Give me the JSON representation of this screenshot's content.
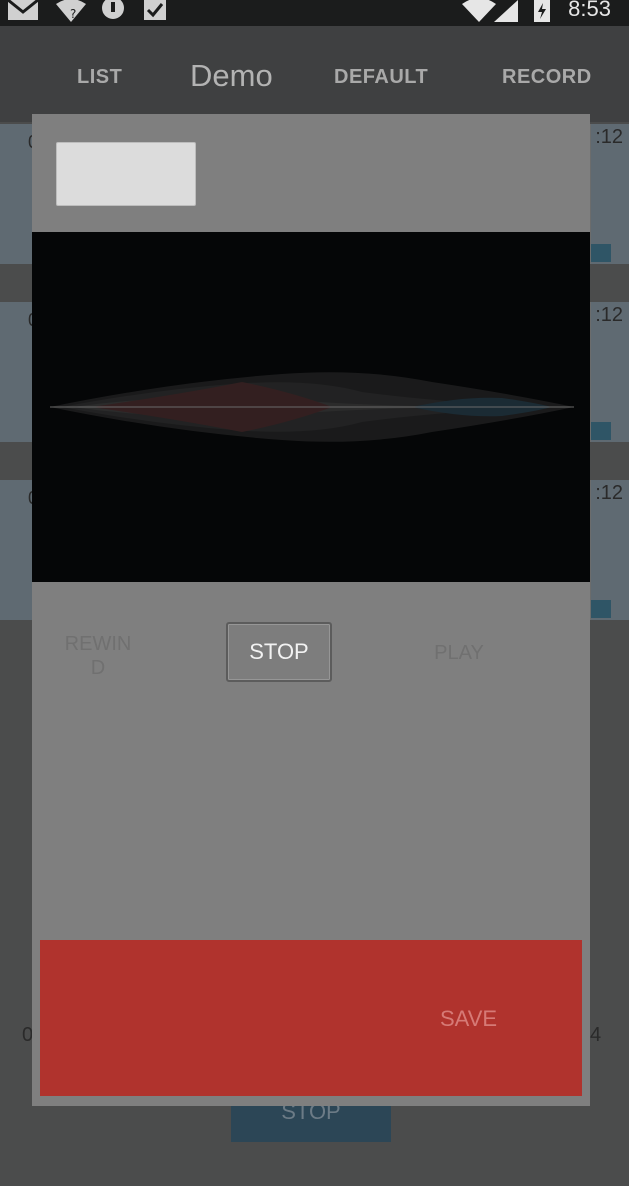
{
  "status_bar": {
    "time": "8:53",
    "icons": [
      "gmail-icon",
      "wifi-question-icon",
      "notification-icon",
      "check-icon",
      "wifi-icon",
      "signal-icon",
      "battery-charging-icon"
    ]
  },
  "app_bar": {
    "title": "Demo",
    "tabs": [
      "LIST",
      "DEFAULT",
      "RECORD"
    ]
  },
  "background_list": {
    "rows": [
      {
        "duration": ":12",
        "prefix": "0"
      },
      {
        "duration": ":12",
        "prefix": "0"
      },
      {
        "duration": ":12",
        "prefix": "0"
      }
    ],
    "bottom_left": "0",
    "bottom_right": "4",
    "stop_button": "STOP"
  },
  "dialog": {
    "buttons": {
      "rewind": "REWIN\nD",
      "stop": "STOP",
      "play": "PLAY"
    },
    "save_label": "SAVE"
  },
  "colors": {
    "save_bar": "#b0332d",
    "accent_blue": "#2f5566",
    "dialog_bg": "#7f7f7f",
    "wave_bg": "#050607"
  }
}
